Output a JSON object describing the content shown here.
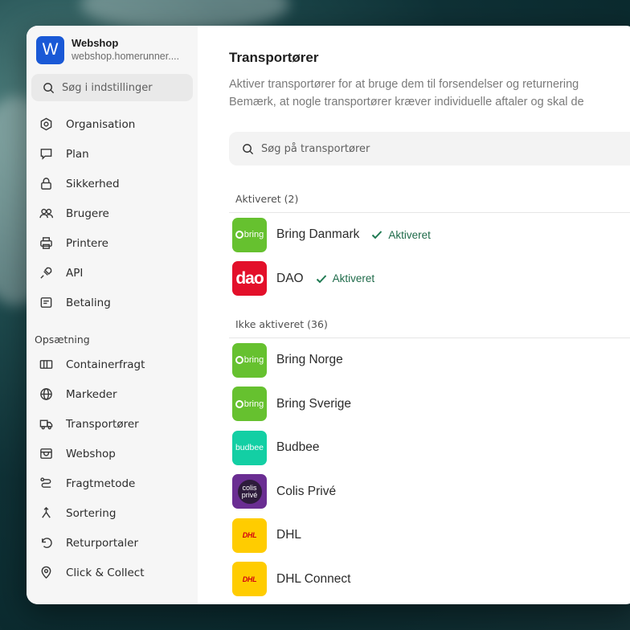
{
  "workspace": {
    "initial": "W",
    "name": "Webshop",
    "url": "webshop.homerunner...."
  },
  "sidebar": {
    "search_placeholder": "Søg i indstillinger",
    "items": [
      {
        "label": "Organisation",
        "icon": "hexagon-icon"
      },
      {
        "label": "Plan",
        "icon": "flag-icon"
      },
      {
        "label": "Sikkerhed",
        "icon": "lock-icon"
      },
      {
        "label": "Brugere",
        "icon": "users-icon"
      },
      {
        "label": "Printere",
        "icon": "printer-icon"
      },
      {
        "label": "API",
        "icon": "plug-icon"
      },
      {
        "label": "Betaling",
        "icon": "receipt-icon"
      }
    ],
    "section_title": "Opsætning",
    "setup_items": [
      {
        "label": "Containerfragt",
        "icon": "container-icon"
      },
      {
        "label": "Markeder",
        "icon": "globe-icon"
      },
      {
        "label": "Transportører",
        "icon": "truck-icon"
      },
      {
        "label": "Webshop",
        "icon": "store-icon"
      },
      {
        "label": "Fragtmetode",
        "icon": "route-icon"
      },
      {
        "label": "Sortering",
        "icon": "split-icon"
      },
      {
        "label": "Returportaler",
        "icon": "return-icon"
      },
      {
        "label": "Click & Collect",
        "icon": "location-pin-icon"
      }
    ]
  },
  "main": {
    "title": "Transportører",
    "description_line1": "Aktiver transportører for at bruge dem til forsendelser og returnering",
    "description_line2": "Bemærk, at nogle transportører kræver individuelle aftaler og skal de",
    "search_placeholder": "Søg på transportører",
    "active_group": {
      "label": "Aktiveret (2)",
      "carriers": [
        {
          "name": "Bring Danmark",
          "logo": "bring",
          "logo_text": "bring",
          "status": "Aktiveret"
        },
        {
          "name": "DAO",
          "logo": "dao",
          "logo_text": "dao",
          "status": "Aktiveret"
        }
      ]
    },
    "inactive_group": {
      "label": "Ikke aktiveret (36)",
      "carriers": [
        {
          "name": "Bring Norge",
          "logo": "bring",
          "logo_text": "bring"
        },
        {
          "name": "Bring Sverige",
          "logo": "bring",
          "logo_text": "bring"
        },
        {
          "name": "Budbee",
          "logo": "budbee",
          "logo_text": "budbee"
        },
        {
          "name": "Colis Privé",
          "logo": "colis",
          "logo_text": "colis",
          "logo_text2": "privé"
        },
        {
          "name": "DHL",
          "logo": "dhl",
          "logo_text": "DHL"
        },
        {
          "name": "DHL Connect",
          "logo": "dhl",
          "logo_text": "DHL"
        }
      ]
    }
  },
  "colors": {
    "accent": "#1a59d6",
    "status_green": "#1f6b4a",
    "bring_green": "#66c12f",
    "dao_red": "#e3102a",
    "budbee_teal": "#13cfa4",
    "colis_purple": "#6a2d92",
    "dhl_yellow": "#ffcc00"
  }
}
